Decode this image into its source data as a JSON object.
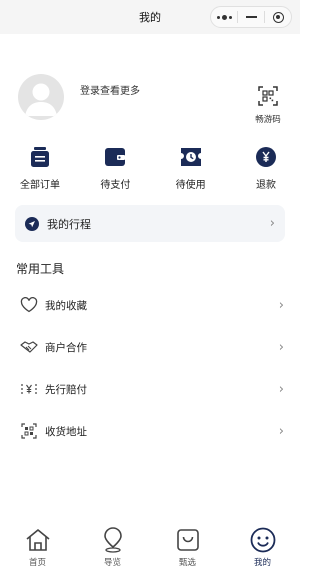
{
  "window": {
    "title": "我的"
  },
  "profile": {
    "login_prompt": "登录查看更多",
    "qr_label": "畅游码"
  },
  "orders": [
    {
      "label": "全部订单",
      "icon": "all-orders-icon"
    },
    {
      "label": "待支付",
      "icon": "wallet-icon"
    },
    {
      "label": "待使用",
      "icon": "ticket-clock-icon"
    },
    {
      "label": "退款",
      "icon": "refund-icon"
    }
  ],
  "trip": {
    "label": "我的行程"
  },
  "tools": {
    "title": "常用工具",
    "items": [
      {
        "label": "我的收藏",
        "icon": "heart-icon"
      },
      {
        "label": "商户合作",
        "icon": "handshake-icon"
      },
      {
        "label": "先行赔付",
        "icon": "yuan-shield-icon"
      },
      {
        "label": "收货地址",
        "icon": "address-icon"
      }
    ]
  },
  "tabbar": {
    "items": [
      {
        "label": "首页",
        "icon": "home-icon"
      },
      {
        "label": "导览",
        "icon": "location-icon"
      },
      {
        "label": "甄选",
        "icon": "shopping-bag-icon"
      },
      {
        "label": "我的",
        "icon": "smile-icon",
        "active": true
      }
    ]
  },
  "colors": {
    "accent": "#1b2b57",
    "top_bar": "#f5f5f5",
    "trip_bg": "#f3f5f8"
  }
}
